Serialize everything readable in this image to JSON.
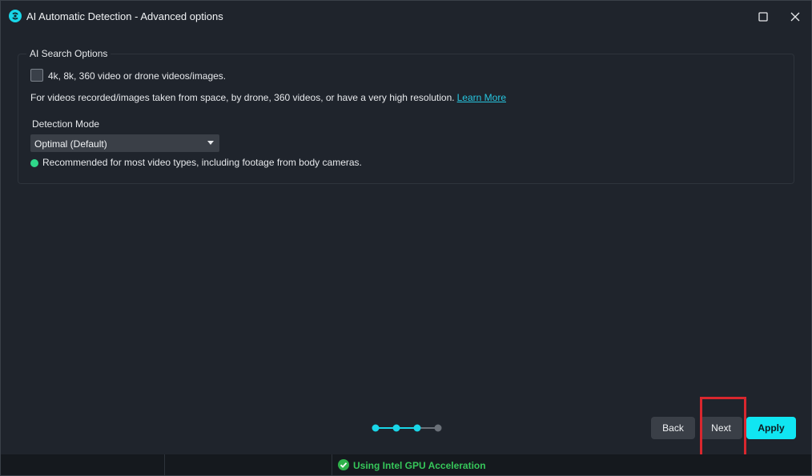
{
  "window": {
    "title": "AI Automatic Detection - Advanced options",
    "icons": {
      "logo": "app-logo-icon",
      "maximize": "maximize-icon",
      "close": "close-icon"
    }
  },
  "search_options": {
    "group_title": "AI Search Options",
    "checkbox_label": "4k, 8k, 360 video or drone videos/images.",
    "checkbox_checked": false,
    "description": "For videos recorded/images taken from space, by drone, 360 videos, or have a very high resolution.",
    "learn_more": "Learn More",
    "detection_mode_label": "Detection Mode",
    "detection_mode_value": "Optimal (Default)",
    "recommendation": "Recommended for most video types, including footage from body cameras."
  },
  "stepper": {
    "total_steps": 4,
    "completed_steps": 3
  },
  "buttons": {
    "back": "Back",
    "next": "Next",
    "apply": "Apply"
  },
  "status_bar": {
    "gpu_text": "Using Intel GPU Acceleration"
  },
  "colors": {
    "accent": "#10e6f2",
    "link": "#27c6e0",
    "success": "#2fd88a",
    "highlight": "#d9272e",
    "background": "#1f242c"
  }
}
